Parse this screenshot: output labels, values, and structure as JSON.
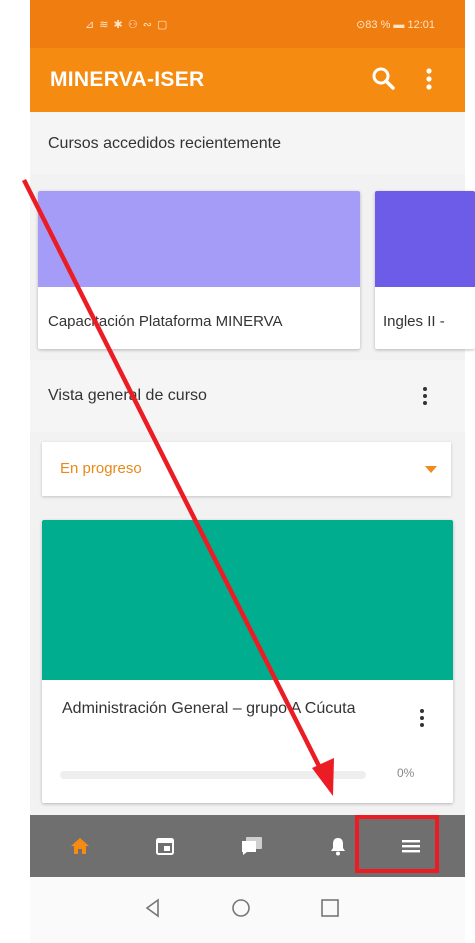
{
  "status_bar": {
    "left_icons": "⊿ ≋ ✱ ⚇ ∾ ▢",
    "right_text": "⊙83 % ▬ 12:01"
  },
  "app_bar": {
    "title": "MINERVA-ISER",
    "search_icon": "search-icon",
    "menu_icon": "more-vert-icon"
  },
  "recent": {
    "title": "Cursos accedidos recientemente",
    "cards": [
      {
        "label": "Capacitación Plataforma MINERVA",
        "color": "#a49cf6"
      },
      {
        "label": "Ingles II -",
        "color": "#6c5ce8"
      }
    ]
  },
  "overview": {
    "title": "Vista general de curso",
    "filter_value": "En progreso",
    "course": {
      "name": "Administración General – grupo A Cúcuta",
      "color": "#00ad8e",
      "progress_percent": 0,
      "progress_label": "0%"
    }
  },
  "bottom_nav": [
    {
      "name": "home-icon",
      "active": true
    },
    {
      "name": "calendar-icon",
      "active": false
    },
    {
      "name": "messages-icon",
      "active": false
    },
    {
      "name": "notifications-icon",
      "active": false
    },
    {
      "name": "more-menu-icon",
      "active": false
    }
  ],
  "colors": {
    "brand_orange": "#f58b11",
    "annotation_red": "#ec1c24"
  }
}
